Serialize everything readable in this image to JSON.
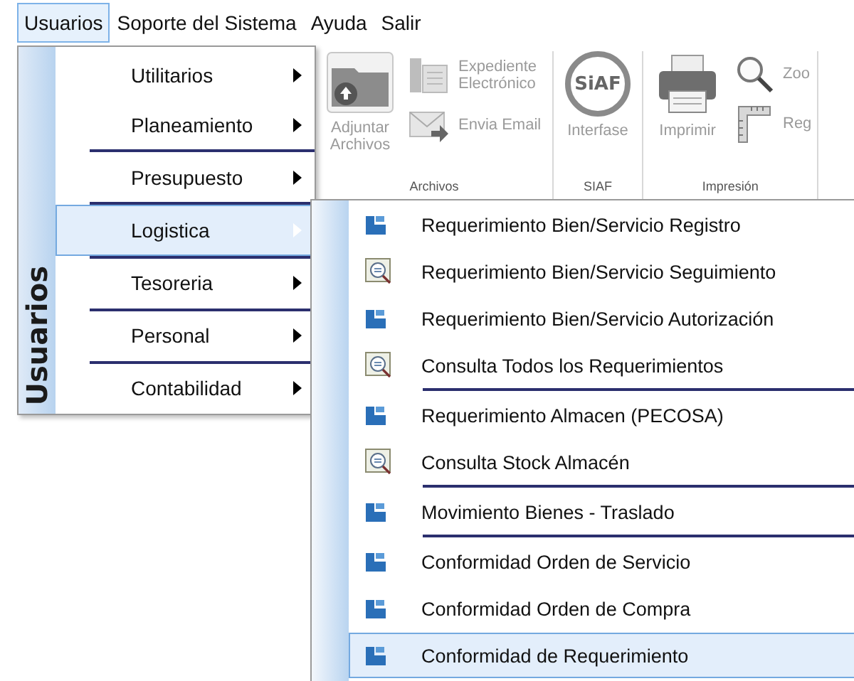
{
  "menubar": [
    {
      "label": "Usuarios",
      "selected": true
    },
    {
      "label": "Soporte del Sistema",
      "selected": false
    },
    {
      "label": "Ayuda",
      "selected": false
    },
    {
      "label": "Salir",
      "selected": false
    }
  ],
  "ribbon": {
    "groups": [
      {
        "title": "Archivos",
        "large": [
          {
            "label": "Adjuntar Archivos",
            "kind": "folder",
            "disabled": true
          }
        ],
        "small": [
          {
            "label": "Expediente Electrónico",
            "kind": "doc",
            "disabled": true
          },
          {
            "label": "Envia Email",
            "kind": "mail",
            "disabled": true
          }
        ]
      },
      {
        "title": "SIAF",
        "large": [
          {
            "label": "Interfase",
            "kind": "siaf",
            "logo_text": "SiAF",
            "disabled": true
          }
        ]
      },
      {
        "title": "Impresión",
        "large": [
          {
            "label": "Imprimir",
            "kind": "printer",
            "disabled": true
          }
        ],
        "small": [
          {
            "label": "Zoo",
            "kind": "zoom",
            "disabled": true
          },
          {
            "label": "Reg",
            "kind": "ruler",
            "disabled": true
          }
        ]
      }
    ]
  },
  "dropdown": {
    "title": "Usuarios",
    "items": [
      {
        "kind": "item",
        "label": "Utilitarios",
        "expanded": false
      },
      {
        "kind": "item",
        "label": "Planeamiento",
        "expanded": false
      },
      {
        "kind": "separator"
      },
      {
        "kind": "item",
        "label": "Presupuesto",
        "expanded": false
      },
      {
        "kind": "separator"
      },
      {
        "kind": "item",
        "label": "Logistica",
        "expanded": true
      },
      {
        "kind": "separator"
      },
      {
        "kind": "item",
        "label": "Tesoreria",
        "expanded": false
      },
      {
        "kind": "separator"
      },
      {
        "kind": "item",
        "label": "Personal",
        "expanded": false
      },
      {
        "kind": "separator"
      },
      {
        "kind": "item",
        "label": "Contabilidad",
        "expanded": false
      }
    ]
  },
  "submenu": {
    "items": [
      {
        "kind": "form",
        "label": "Requerimiento Bien/Servicio Registro",
        "selected": false
      },
      {
        "kind": "query",
        "label": "Requerimiento Bien/Servicio Seguimiento",
        "selected": false
      },
      {
        "kind": "form",
        "label": "Requerimiento Bien/Servicio Autorización",
        "selected": false
      },
      {
        "kind": "query",
        "label": "Consulta Todos los Requerimientos",
        "selected": false
      },
      {
        "kind": "separator"
      },
      {
        "kind": "form",
        "label": "Requerimiento Almacen (PECOSA)",
        "selected": false
      },
      {
        "kind": "query",
        "label": "Consulta Stock Almacén",
        "selected": false
      },
      {
        "kind": "separator"
      },
      {
        "kind": "form",
        "label": "Movimiento Bienes - Traslado",
        "selected": false
      },
      {
        "kind": "separator"
      },
      {
        "kind": "form",
        "label": "Conformidad Orden de Servicio",
        "selected": false
      },
      {
        "kind": "form",
        "label": "Conformidad Orden de Compra",
        "selected": false
      },
      {
        "kind": "form",
        "label": "Conformidad de Requerimiento",
        "selected": true
      }
    ]
  }
}
